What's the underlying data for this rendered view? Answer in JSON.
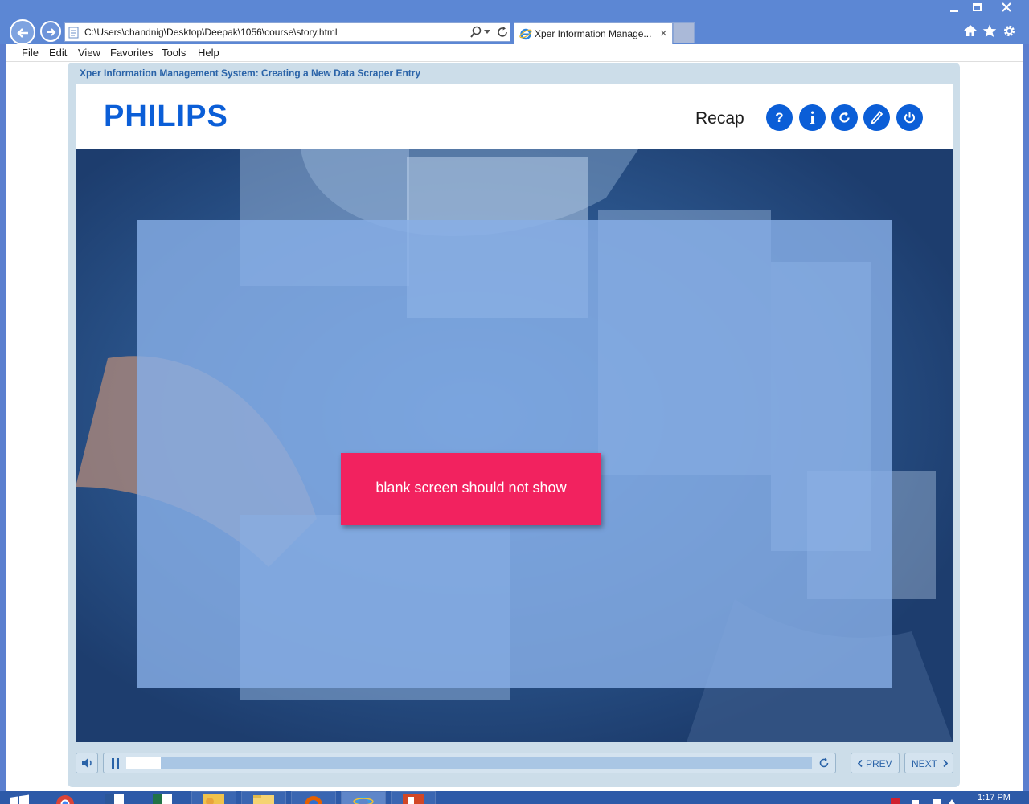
{
  "browser": {
    "address": "C:\\Users\\chandnig\\Desktop\\Deepak\\1056\\course\\story.html",
    "tab_title": "Xper Information Manage...",
    "tab_close": "×",
    "menu": [
      "File",
      "Edit",
      "View",
      "Favorites",
      "Tools",
      "Help"
    ]
  },
  "course": {
    "title": "Xper Information Management System: Creating a New Data Scraper Entry",
    "logo": "PHILIPS",
    "section": "Recap",
    "header_buttons": [
      {
        "name": "help",
        "label": "?"
      },
      {
        "name": "info",
        "label": "i"
      },
      {
        "name": "replay",
        "icon": "refresh-icon"
      },
      {
        "name": "edit",
        "icon": "pencil-icon"
      },
      {
        "name": "power",
        "icon": "power-icon"
      }
    ]
  },
  "stage": {
    "alert_text": "blank screen should not show",
    "colors": {
      "alert": "#f2225f",
      "panel": "#87afe6",
      "brand": "#0b5ed7"
    }
  },
  "playback": {
    "progress": 0.05,
    "prev_label": "PREV",
    "next_label": "NEXT"
  },
  "taskbar": {
    "clock": "1:17 PM"
  }
}
